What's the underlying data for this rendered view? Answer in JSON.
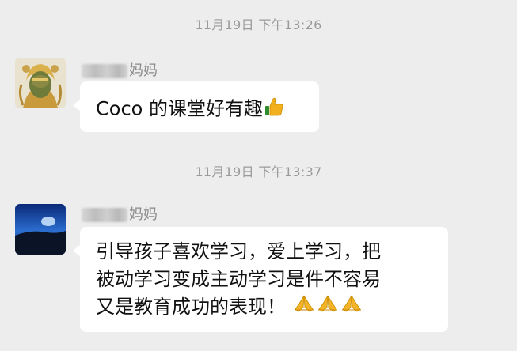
{
  "messages": [
    {
      "timestamp": "11月19日 下午13:26",
      "sender_suffix": "妈妈",
      "text": "Coco 的课堂好有趣",
      "trailing_emoji": "thumbs-up-icon"
    },
    {
      "timestamp": "11月19日 下午13:37",
      "sender_suffix": "妈妈",
      "lines": [
        "引导孩子喜欢学习，爱上学习，把",
        "被动学习变成主动学习是件不容易",
        "又是教育成功的表现！"
      ],
      "trailing_emoji": "praying-hands-icon"
    }
  ],
  "colors": {
    "background": "#ededed",
    "bubble": "#ffffff",
    "timestamp_text": "#9a9a9a",
    "sender_text": "#8a8a8a"
  }
}
